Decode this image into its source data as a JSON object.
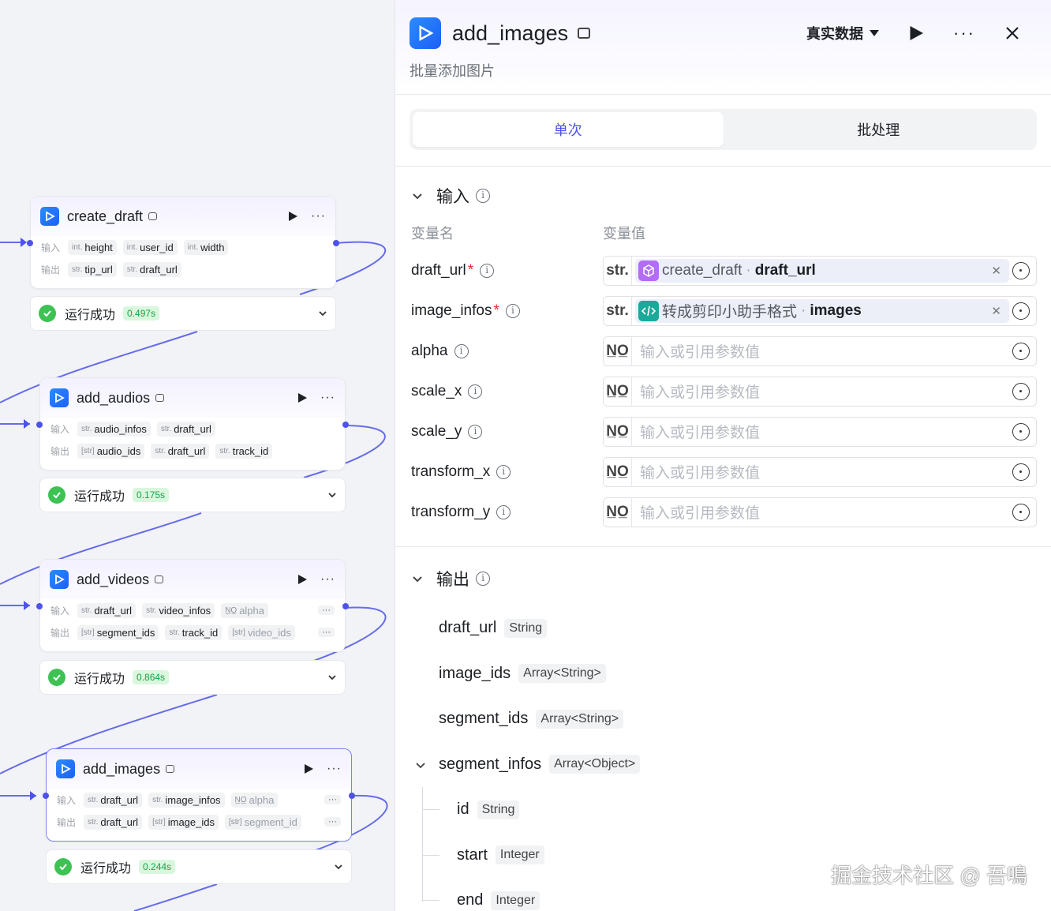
{
  "canvas": {
    "nodes": [
      {
        "title": "create_draft",
        "inputs": [
          {
            "type": "int.",
            "name": "height"
          },
          {
            "type": "int.",
            "name": "user_id"
          },
          {
            "type": "int.",
            "name": "width"
          }
        ],
        "outputs": [
          {
            "type": "str.",
            "name": "tip_url"
          },
          {
            "type": "str.",
            "name": "draft_url"
          }
        ],
        "status": "运行成功",
        "time": "0.497s"
      },
      {
        "title": "add_audios",
        "inputs": [
          {
            "type": "str.",
            "name": "audio_infos"
          },
          {
            "type": "str.",
            "name": "draft_url"
          }
        ],
        "outputs": [
          {
            "type": "[str]",
            "name": "audio_ids"
          },
          {
            "type": "str.",
            "name": "draft_url"
          },
          {
            "type": "str.",
            "name": "track_id"
          }
        ],
        "status": "运行成功",
        "time": "0.175s"
      },
      {
        "title": "add_videos",
        "inputs": [
          {
            "type": "str.",
            "name": "draft_url"
          },
          {
            "type": "str.",
            "name": "video_infos"
          },
          {
            "type": "N̲O̲",
            "name": "alpha"
          }
        ],
        "outputs": [
          {
            "type": "[str]",
            "name": "segment_ids"
          },
          {
            "type": "str.",
            "name": "track_id"
          },
          {
            "type": "[str]",
            "name": "video_ids"
          }
        ],
        "more": "···",
        "status": "运行成功",
        "time": "0.864s"
      },
      {
        "title": "add_images",
        "inputs": [
          {
            "type": "str.",
            "name": "draft_url"
          },
          {
            "type": "str.",
            "name": "image_infos"
          },
          {
            "type": "N̲O̲",
            "name": "alpha"
          }
        ],
        "outputs": [
          {
            "type": "str.",
            "name": "draft_url"
          },
          {
            "type": "[str]",
            "name": "image_ids"
          },
          {
            "type": "[str]",
            "name": "segment_id"
          }
        ],
        "more": "···",
        "status": "运行成功",
        "time": "0.244s"
      }
    ],
    "io_labels": {
      "input": "输入",
      "output": "输出"
    },
    "more_icon": "···"
  },
  "panel": {
    "title": "add_images",
    "description": "批量添加图片",
    "data_mode": "真实数据",
    "more_icon": "···",
    "tabs": [
      {
        "label": "单次",
        "active": true
      },
      {
        "label": "批处理",
        "active": false
      }
    ],
    "input_section": {
      "title": "输入",
      "col_name": "变量名",
      "col_value": "变量值",
      "params": [
        {
          "name": "draft_url",
          "required": "*",
          "type": "str.",
          "ref_source": "create_draft",
          "ref_field": "draft_url",
          "ref_color": "#b36cf5"
        },
        {
          "name": "image_infos",
          "required": "*",
          "type": "str.",
          "ref_source": "转成剪印小助手格式",
          "ref_field": "images",
          "ref_color": "#1aa99a"
        },
        {
          "name": "alpha",
          "type": "N̲O̲",
          "placeholder": "输入或引用参数值"
        },
        {
          "name": "scale_x",
          "type": "N̲O̲",
          "placeholder": "输入或引用参数值"
        },
        {
          "name": "scale_y",
          "type": "N̲O̲",
          "placeholder": "输入或引用参数值"
        },
        {
          "name": "transform_x",
          "type": "N̲O̲",
          "placeholder": "输入或引用参数值"
        },
        {
          "name": "transform_y",
          "type": "N̲O̲",
          "placeholder": "输入或引用参数值"
        }
      ]
    },
    "output_section": {
      "title": "输出",
      "fields": [
        {
          "name": "draft_url",
          "type": "String"
        },
        {
          "name": "image_ids",
          "type": "Array<String>"
        },
        {
          "name": "segment_ids",
          "type": "Array<String>"
        },
        {
          "name": "segment_infos",
          "type": "Array<Object>"
        }
      ],
      "children": [
        {
          "name": "id",
          "type": "String"
        },
        {
          "name": "start",
          "type": "Integer"
        },
        {
          "name": "end",
          "type": "Integer"
        }
      ]
    }
  },
  "watermark": "掘金技术社区 @ 吾鳴",
  "colors": {
    "accent": "#4d53e8",
    "success": "#3ec254",
    "edge": "#4d53e8"
  }
}
